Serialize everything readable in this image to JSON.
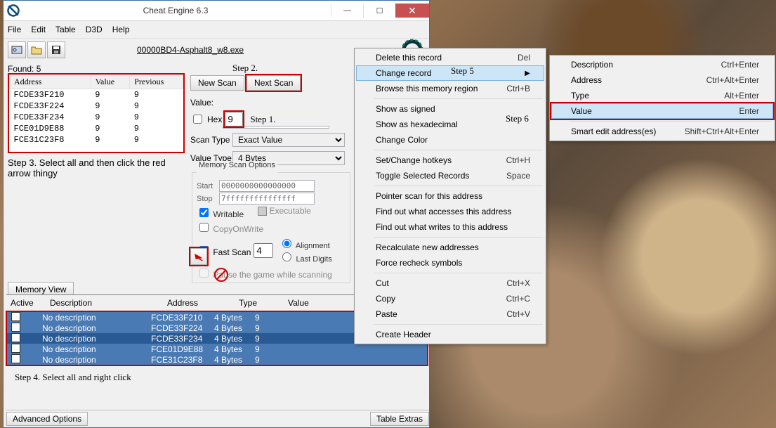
{
  "window": {
    "title": "Cheat Engine 6.3"
  },
  "menu": {
    "file": "File",
    "edit": "Edit",
    "table": "Table",
    "d3d": "D3D",
    "help": "Help"
  },
  "process": "00000BD4-Asphalt8_w8.exe",
  "found_label": "Found: 5",
  "columns": {
    "address": "Address",
    "value": "Value",
    "previous": "Previous"
  },
  "results": [
    {
      "addr": "FCDE33F210",
      "val": "9",
      "prev": "9"
    },
    {
      "addr": "FCDE33F224",
      "val": "9",
      "prev": "9"
    },
    {
      "addr": "FCDE33F234",
      "val": "9",
      "prev": "9"
    },
    {
      "addr": "FCE01D9E88",
      "val": "9",
      "prev": "9"
    },
    {
      "addr": "FCE31C23F8",
      "val": "9",
      "prev": "9"
    }
  ],
  "steps": {
    "s1": "Step 1.",
    "s2": "Step 2.",
    "s3": "Step 3. Select all and then click the red arrow thingy",
    "s4": "Step 4. Select all and right click",
    "s5": "Step 5",
    "s6": "Step 6"
  },
  "scan": {
    "new": "New Scan",
    "next": "Next Scan",
    "hex": "Hex",
    "value_label": "Value:",
    "value": "9",
    "scan_type_label": "Scan Type",
    "scan_type": "Exact Value",
    "value_type_label": "Value Type",
    "value_type": "4 Bytes",
    "memopts": "Memory Scan Options",
    "start": "Start",
    "start_v": "0000000000000000",
    "stop": "Stop",
    "stop_v": "7fffffffffffffff",
    "writable": "Writable",
    "executable": "Executable",
    "cow": "CopyOnWrite",
    "fast": "Fast Scan",
    "fast_v": "4",
    "align": "Alignment",
    "lastd": "Last Digits",
    "pause": "Pause the game while scanning"
  },
  "memview": "Memory View",
  "bottom": {
    "cols": {
      "active": "Active",
      "desc": "Description",
      "addr": "Address",
      "type": "Type",
      "val": "Value"
    },
    "rows": [
      {
        "desc": "No description",
        "addr": "FCDE33F210",
        "type": "4 Bytes",
        "val": "9",
        "sel": false
      },
      {
        "desc": "No description",
        "addr": "FCDE33F224",
        "type": "4 Bytes",
        "val": "9",
        "sel": false
      },
      {
        "desc": "No description",
        "addr": "FCDE33F234",
        "type": "4 Bytes",
        "val": "9",
        "sel": true
      },
      {
        "desc": "No description",
        "addr": "FCE01D9E88",
        "type": "4 Bytes",
        "val": "9",
        "sel": false
      },
      {
        "desc": "No description",
        "addr": "FCE31C23F8",
        "type": "4 Bytes",
        "val": "9",
        "sel": false
      }
    ]
  },
  "footer": {
    "adv": "Advanced Options",
    "tbl": "Table Extras"
  },
  "ctx1": [
    {
      "t": "Delete this record",
      "sc": "Del"
    },
    {
      "t": "Change record",
      "sub": true,
      "hi": true
    },
    {
      "t": "Browse this memory region",
      "sc": "Ctrl+B"
    },
    {
      "sep": true
    },
    {
      "t": "Show as signed"
    },
    {
      "t": "Show as hexadecimal"
    },
    {
      "t": "Change Color"
    },
    {
      "sep": true
    },
    {
      "t": "Set/Change hotkeys",
      "sc": "Ctrl+H"
    },
    {
      "t": "Toggle Selected Records",
      "sc": "Space"
    },
    {
      "sep": true
    },
    {
      "t": "Pointer scan for this address"
    },
    {
      "t": "Find out what accesses this address"
    },
    {
      "t": "Find out what writes to this address"
    },
    {
      "sep": true
    },
    {
      "t": "Recalculate new addresses"
    },
    {
      "t": "Force recheck symbols"
    },
    {
      "sep": true
    },
    {
      "t": "Cut",
      "sc": "Ctrl+X"
    },
    {
      "t": "Copy",
      "sc": "Ctrl+C"
    },
    {
      "t": "Paste",
      "sc": "Ctrl+V"
    },
    {
      "sep": true
    },
    {
      "t": "Create Header"
    }
  ],
  "ctx2": [
    {
      "t": "Description",
      "sc": "Ctrl+Enter"
    },
    {
      "t": "Address",
      "sc": "Ctrl+Alt+Enter"
    },
    {
      "t": "Type",
      "sc": "Alt+Enter"
    },
    {
      "t": "Value",
      "sc": "Enter",
      "hi": true
    },
    {
      "sep": true
    },
    {
      "t": "Smart edit address(es)",
      "sc": "Shift+Ctrl+Alt+Enter"
    }
  ]
}
